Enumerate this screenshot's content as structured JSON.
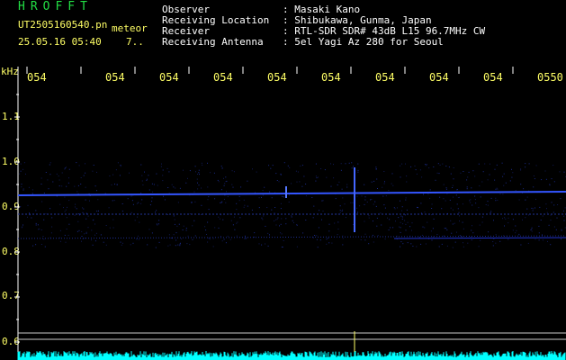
{
  "header": {
    "app_title": "HROFFT",
    "filename": "UT2505160540.pn",
    "mode_label": "meteor",
    "datetime": "25.05.16 05:40",
    "count": "7..",
    "fields": [
      {
        "label": "Observer",
        "value": ": Masaki Kano"
      },
      {
        "label": "Receiving Location",
        "value": ": Shibukawa, Gunma, Japan"
      },
      {
        "label": "Receiver",
        "value": ": RTL-SDR SDR# 43dB L15 96.7MHz CW"
      },
      {
        "label": "Receiving Antenna",
        "value": ": 5el Yagi Az 280 for Seoul"
      }
    ]
  },
  "y_axis": {
    "unit": "kHz",
    "ticks": [
      "1.1",
      "1.0",
      "0.9",
      "0.8",
      "0.7",
      "0.6"
    ]
  },
  "x_axis": {
    "ticks": [
      "054",
      "054",
      "054",
      "054",
      "054",
      "054",
      "054",
      "054",
      "054",
      "0550"
    ]
  },
  "colors": {
    "background": "#000000",
    "title_green": "#22dd44",
    "label_yellow": "#ffff66",
    "signal_blue": "#3355ff",
    "spectrum_cyan": "#00ffff"
  }
}
